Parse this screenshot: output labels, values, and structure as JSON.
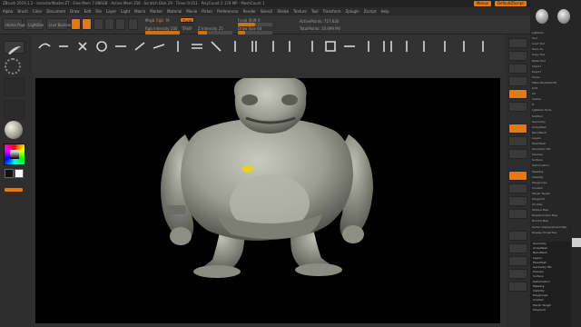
{
  "titlebar": {
    "text": "ZBrush 2019.1.2  ·  monsterMaster.ZT  ·  Free Mem 7.086GB  ·  Active Mem 356  ·  Scratch Disk 29  ·  Timer 0.011  ·  PolyCount 2.174 MP  ·  MeshCount 1",
    "chips": [
      "Menus",
      "DefaultZScript"
    ]
  },
  "menubar": {
    "items": [
      "Alpha",
      "Brush",
      "Color",
      "Document",
      "Draw",
      "Edit",
      "File",
      "Layer",
      "Light",
      "Macro",
      "Marker",
      "Material",
      "Movie",
      "Picker",
      "Preferences",
      "Render",
      "Stencil",
      "Stroke",
      "Texture",
      "Tool",
      "Transform",
      "Zplugin",
      "Zscript",
      "Help"
    ]
  },
  "topshelf": {
    "buttons": [
      "Home Page",
      "LightBox",
      "Live Boolean"
    ],
    "mrgb": "Mrgb",
    "rgb": "Rgb",
    "m": "M",
    "zadd": "Zadd",
    "zsub": "Zsub",
    "focal_shift": "Focal Shift 0",
    "draw_size": "Draw Size 64",
    "rgb_intensity": "Rgb Intensity 100",
    "z_intensity": "Z Intensity 25",
    "active_points": "ActivePoints: 727,626",
    "total_points": "TotalPoints: 10.699 Mil"
  },
  "lefttools": {
    "quick_sketch": "Quick Sketch"
  },
  "brushes": [
    "ClayBuildup",
    "Standard",
    "Move",
    "Inflat",
    "DamStandard",
    "hPolish",
    "TrimDynamic",
    "Pinch",
    "Layer",
    "Slash3",
    "Orb_Flatten",
    "Orb_Cracks",
    "Orb_Pinch",
    "Orb_Slash",
    "Orb_Crease",
    "ZModeler",
    "Smooth",
    "Snakehook",
    "CurveTube",
    "Planar",
    "Morph",
    "IMM",
    "Chisel",
    "Mallet"
  ],
  "canvas": {
    "background": "#000000",
    "model_color": "#9ea096",
    "highlight": "#e8d21a"
  },
  "tray": {
    "rows": [
      "Lightbox",
      "Tool",
      "Load Tool",
      "Save As",
      "Copy Tool",
      "Paste Tool",
      "Import",
      "Export",
      "Clone",
      "Make PolyMesh3D",
      "GoZ",
      "All",
      "Visible",
      "R",
      "Lightbox Tools",
      "SubTool",
      "Geometry",
      "ArrayMesh",
      "NanoMesh",
      "Layers",
      "FiberMesh",
      "Geometry HD",
      "Preview",
      "Surface",
      "Deformation",
      "Masking",
      "Visibility",
      "Polygroups",
      "Contact",
      "Morph Target",
      "Polypaint",
      "UV Map",
      "Texture Map",
      "Displacement Map",
      "Normal Map",
      "Vector Displacement Map",
      "Display Properties",
      "Unified Skin",
      "Initialize",
      "Import",
      "Export"
    ],
    "list": [
      "Geometry",
      "ArrayMesh",
      "NanoMesh",
      "Layers",
      "FiberMesh",
      "Geometry HD",
      "Preview",
      "Surface",
      "Deformation",
      "Masking",
      "Visibility",
      "Polygroups",
      "Contact",
      "Morph Target",
      "Polypaint"
    ]
  },
  "colors": {
    "accent": "#e37a10",
    "panel": "#303030",
    "dark": "#222222"
  }
}
